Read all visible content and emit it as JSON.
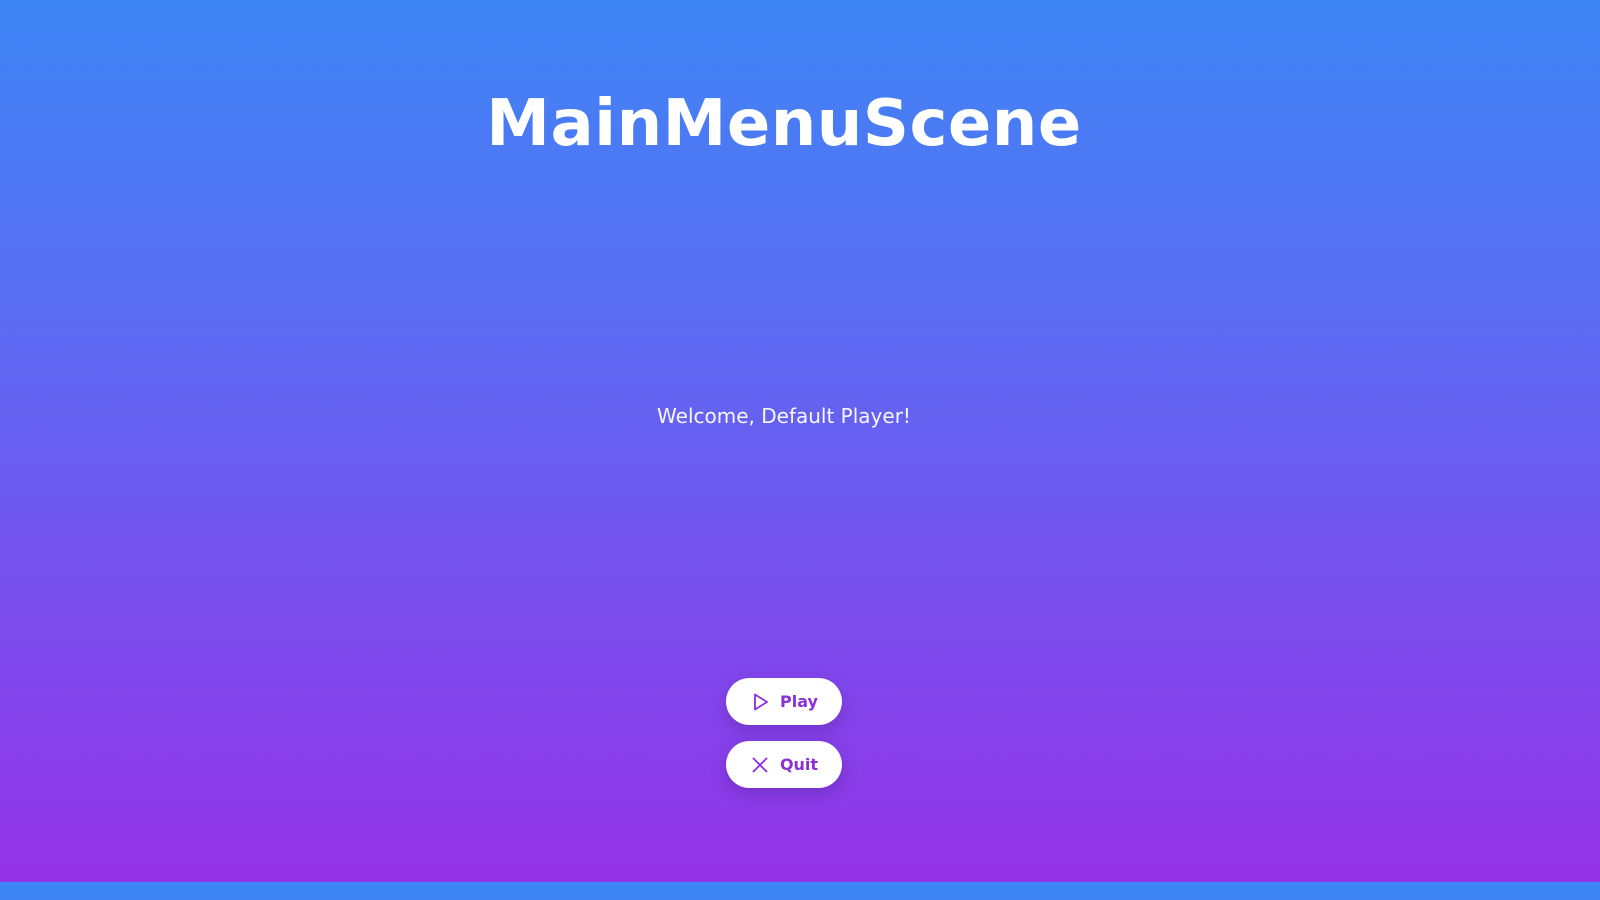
{
  "scene": {
    "title": "MainMenuScene",
    "welcome_text": "Welcome, Default Player!"
  },
  "menu": {
    "play_label": "Play",
    "play_icon": "play-icon",
    "quit_label": "Quit",
    "quit_icon": "close-icon"
  },
  "colors": {
    "gradient_top": "#3e86f6",
    "gradient_bottom": "#9333e6",
    "button_background": "#ffffff",
    "button_text": "#8b2fd9"
  }
}
